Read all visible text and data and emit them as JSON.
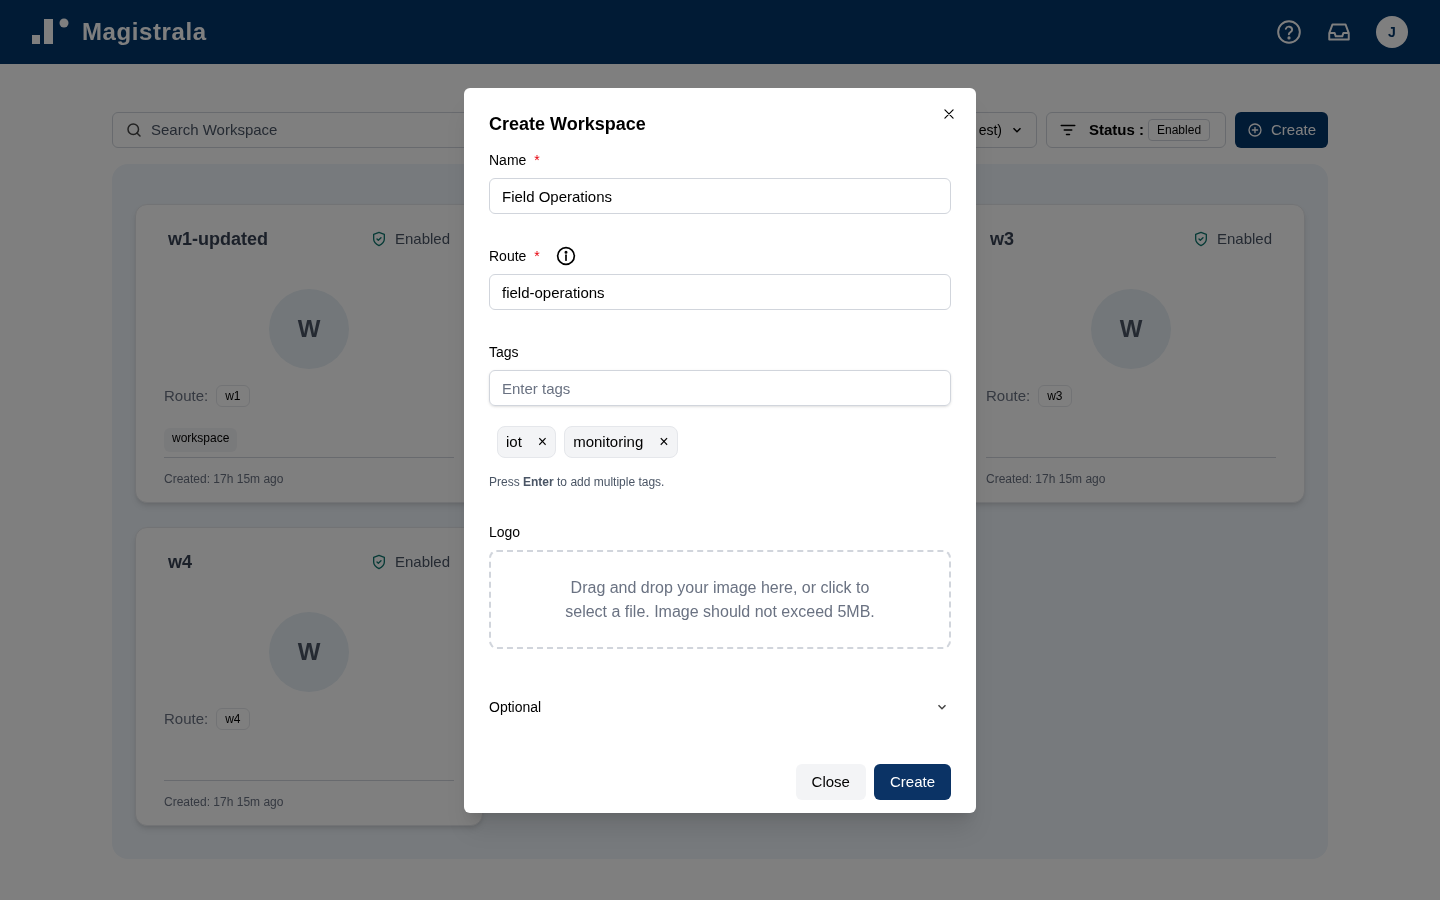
{
  "header": {
    "logo_text": "Magistrala",
    "avatar_initial": "J"
  },
  "toolbar": {
    "search": {
      "placeholder": "Search Workspace"
    },
    "sort_text": "est)",
    "filter": {
      "label": "Status :",
      "value": "Enabled"
    },
    "create_button": "Create"
  },
  "cards": [
    {
      "name": "w1-updated",
      "status": "Enabled",
      "avatar_letter": "W",
      "route_label": "Route:",
      "route": "w1",
      "tags": [
        "workspace"
      ],
      "created": "Created: 17h 15m ago"
    },
    {
      "name": "w3",
      "status": "Enabled",
      "avatar_letter": "W",
      "route_label": "Route:",
      "route": "w3",
      "created": "Created: 17h 15m ago"
    },
    {
      "name": "w4",
      "status": "Enabled",
      "avatar_letter": "W",
      "route_label": "Route:",
      "route": "w4",
      "created": "Created: 17h 15m ago"
    }
  ],
  "dialog": {
    "title": "Create Workspace",
    "name_field": {
      "label": "Name",
      "required_mark": "*",
      "value": "Field Operations"
    },
    "route_field": {
      "label": "Route",
      "required_mark": "*",
      "value": "field-operations"
    },
    "tags_field": {
      "label": "Tags",
      "placeholder": "Enter tags",
      "chips": [
        "iot",
        "monitoring"
      ],
      "chip_remove": "×",
      "hint": "Press **Enter** to add multiple tags."
    },
    "logo_field": {
      "label": "Logo",
      "dropzone_text": "Drag and drop your image here, or click to select a file. Image should not exceed 5MB."
    },
    "optional": {
      "label": "Optional",
      "expanded": false
    },
    "buttons": [
      {
        "label": "Close",
        "kind": "secondary"
      },
      {
        "label": "Create",
        "kind": "primary"
      }
    ]
  }
}
